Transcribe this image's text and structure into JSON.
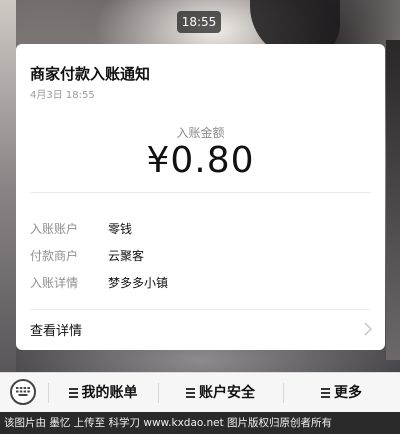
{
  "status_time": "18:55",
  "notification": {
    "title": "商家付款入账通知",
    "date": "4月3日  18:55",
    "amount_label": "入账金额",
    "amount": "¥0.80",
    "rows": [
      {
        "key": "入账账户",
        "value": "零钱"
      },
      {
        "key": "付款商户",
        "value": "云聚客"
      },
      {
        "key": "入账详情",
        "value": "梦多多小镇"
      }
    ],
    "detail_link": "查看详情"
  },
  "bottom_menu": {
    "items": [
      {
        "label": "我的账单"
      },
      {
        "label": "账户安全"
      },
      {
        "label": "更多"
      }
    ]
  },
  "footer_text": "该图片由 墨忆 上传至 科学刀 www.kxdao.net 图片版权归原创者所有",
  "icons": {
    "keyboard": "keyboard-icon",
    "menu": "menu-lines-icon",
    "chevron": "chevron-right-icon"
  }
}
